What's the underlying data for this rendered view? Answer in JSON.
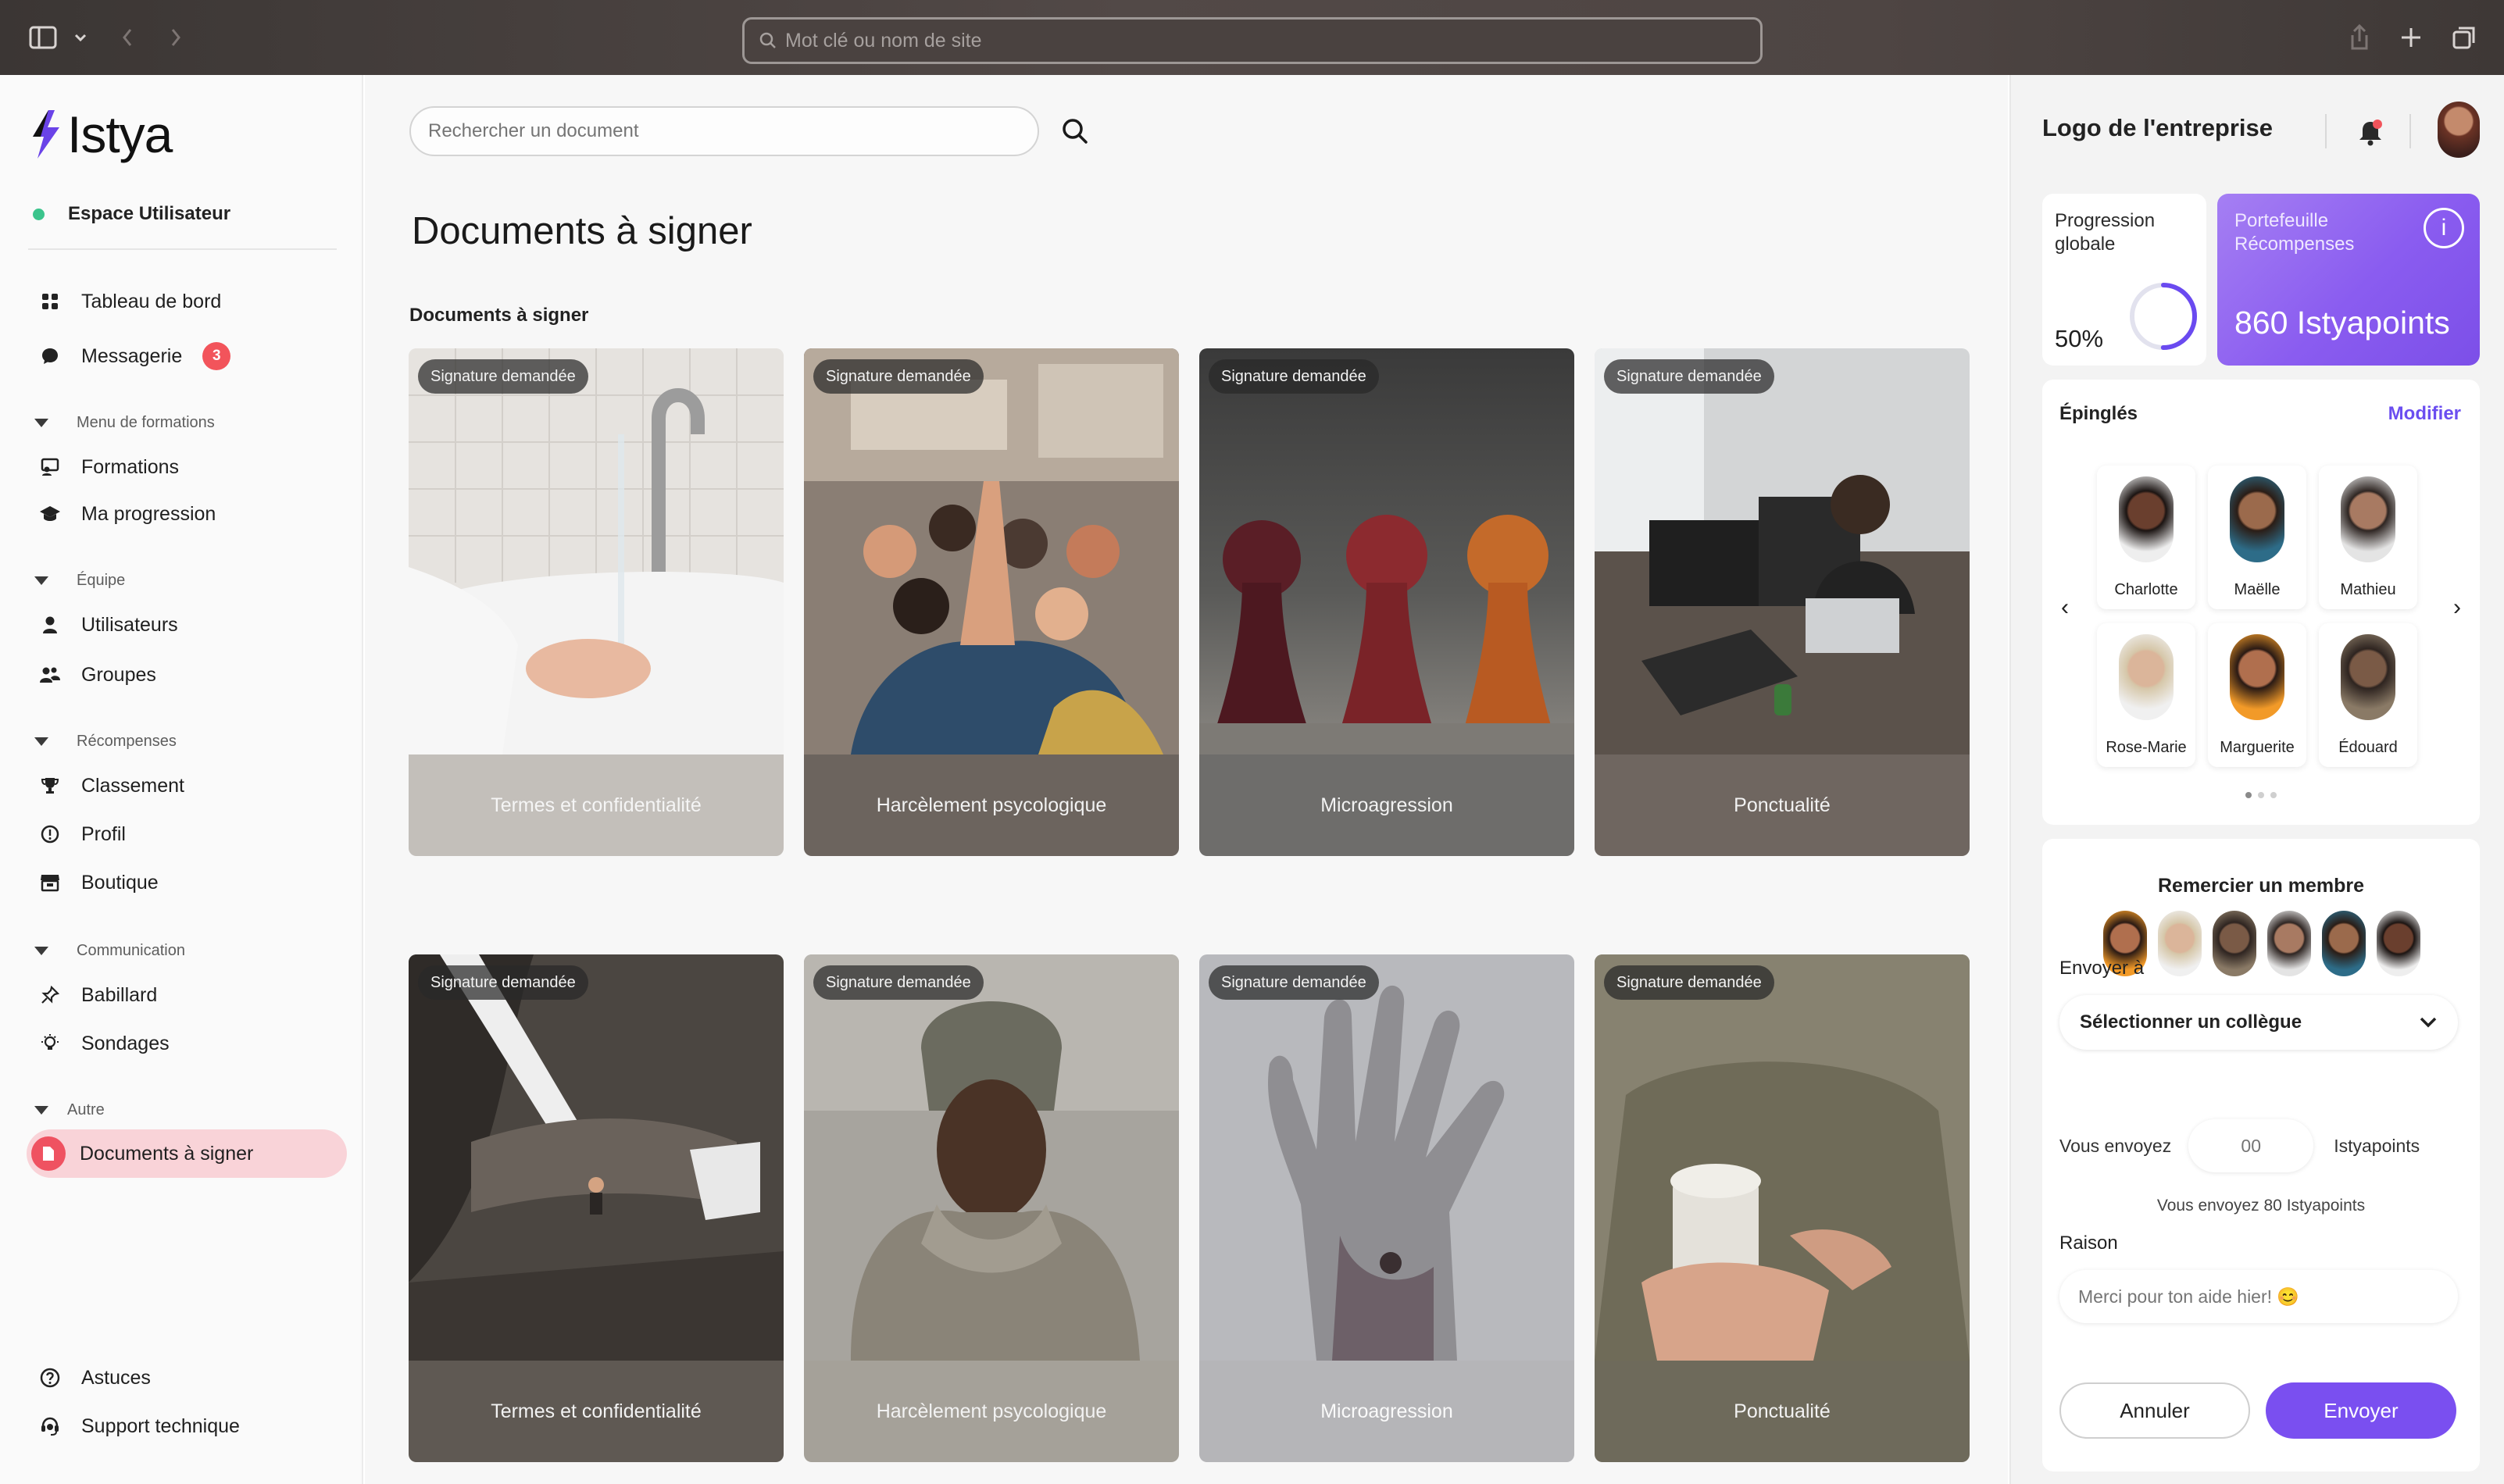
{
  "browser": {
    "address_placeholder": "Mot clé ou nom de site"
  },
  "sidebar": {
    "brand": "Istya",
    "space": "Espace Utilisateur",
    "items": {
      "dashboard": "Tableau de bord",
      "messages": "Messagerie",
      "messages_badge": "3",
      "section_trainings": "Menu de formations",
      "trainings": "Formations",
      "progress": "Ma progression",
      "section_team": "Équipe",
      "users": "Utilisateurs",
      "groups": "Groupes",
      "section_rewards": "Récompenses",
      "ranking": "Classement",
      "profile": "Profil",
      "shop": "Boutique",
      "section_communication": "Communication",
      "board": "Babillard",
      "surveys": "Sondages",
      "section_other": "Autre",
      "documents": "Documents à signer",
      "tips": "Astuces",
      "support": "Support technique"
    }
  },
  "main": {
    "search_placeholder": "Rechercher un document",
    "title": "Documents à signer",
    "section": "Documents à signer",
    "cards": [
      {
        "tag": "Signature demandée",
        "title": "Termes et confidentialité"
      },
      {
        "tag": "Signature demandée",
        "title": "Harcèlement psycologique"
      },
      {
        "tag": "Signature demandée",
        "title": "Microagression"
      },
      {
        "tag": "Signature demandée",
        "title": "Ponctualité"
      },
      {
        "tag": "Signature demandée",
        "title": "Termes et confidentialité"
      },
      {
        "tag": "Signature demandée",
        "title": "Harcèlement psycologique"
      },
      {
        "tag": "Signature demandée",
        "title": "Microagression"
      },
      {
        "tag": "Signature demandée",
        "title": "Ponctualité"
      }
    ]
  },
  "right": {
    "company_logo": "Logo de l'entreprise",
    "progress_label": "Progression globale",
    "progress_value": "50%",
    "progress_fraction": 0.5,
    "wallet_label": "Portefeuille Récompenses",
    "wallet_value": "860 Istyapoints",
    "pinned_title": "Épinglés",
    "pinned_edit": "Modifier",
    "pinned": [
      "Charlotte",
      "Maëlle",
      "Mathieu",
      "Rose-Marie",
      "Marguerite",
      "Édouard"
    ],
    "thank_title": "Remercier un membre",
    "send_to_label": "Envoyer à",
    "select_value": "Sélectionner un collègue",
    "you_send": "Vous envoyez",
    "amount_placeholder": "00",
    "unit": "Istyapoints",
    "send_note": "Vous envoyez 80 Istyapoints",
    "reason_label": "Raison",
    "reason_placeholder": "Merci pour ton aide hier! 😊",
    "cancel": "Annuler",
    "send": "Envoyer"
  },
  "colors": {
    "accent": "#7a4ff0",
    "active_bg": "#f9d3d8",
    "active_icon": "#ef5261",
    "online": "#3bc48c",
    "badge": "#f2545b"
  }
}
